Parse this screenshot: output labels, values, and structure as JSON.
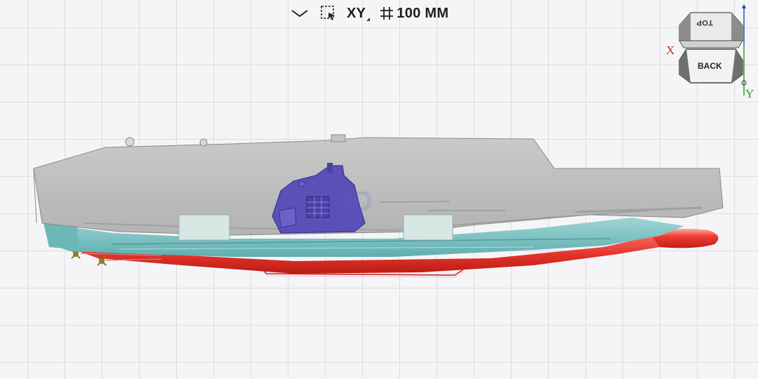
{
  "toolbar": {
    "collapse_icon": "chevron-down-icon",
    "select_icon": "box-select-icon",
    "plane_label": "XY",
    "grid_icon": "grid-size-icon",
    "grid_size_label": "100 MM"
  },
  "viewcube": {
    "top_label": "TOP",
    "back_label": "BACK",
    "x_axis_label": "X",
    "y_axis_label": "Y"
  },
  "model": {
    "name_hint": "aircraft carrier 3D model",
    "colors": {
      "deck": "#bdbdbd",
      "hull_side": "#7fc4c4",
      "hull_bottom": "#e5332a",
      "island": "#5a50b8",
      "panel": "#d7e8e4"
    }
  }
}
